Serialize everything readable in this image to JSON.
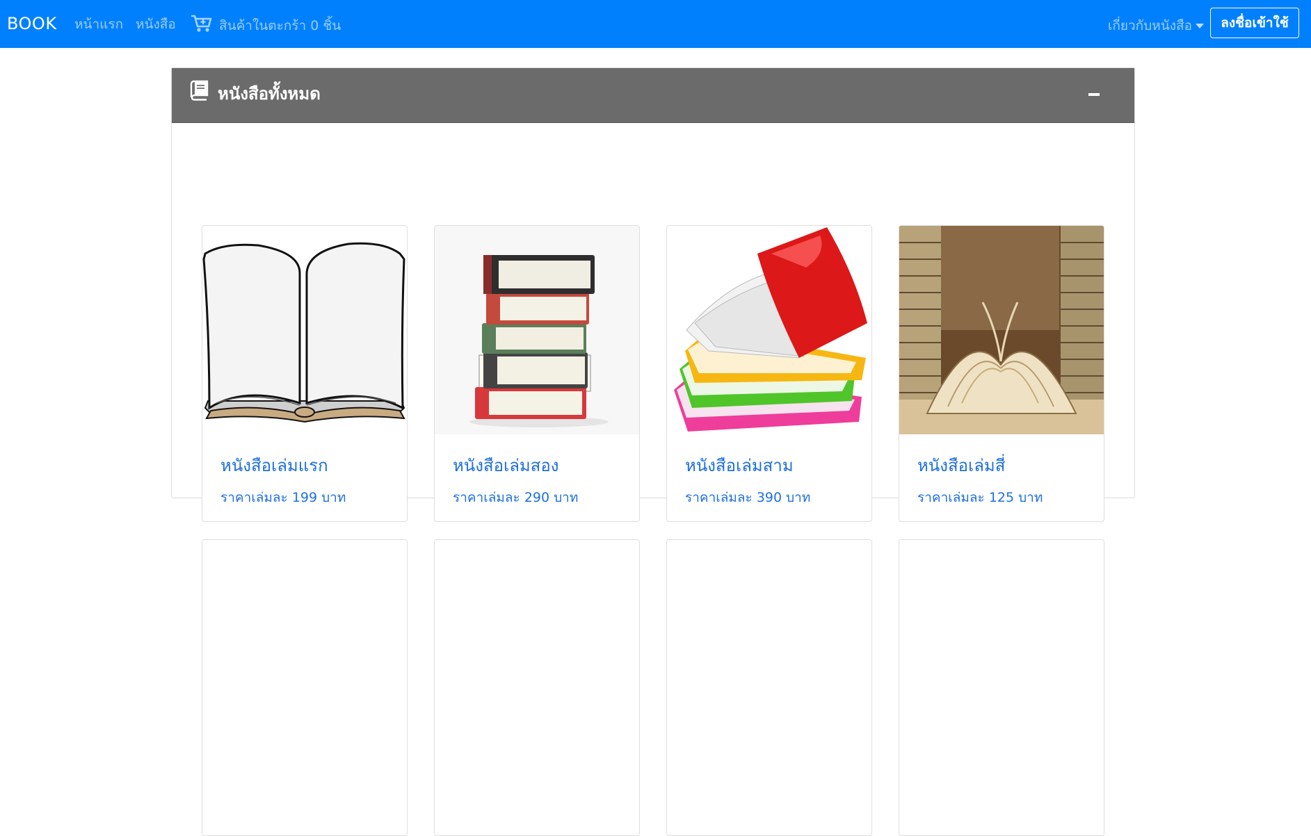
{
  "navbar": {
    "brand": "BOOK",
    "links": [
      "หน้าแรก",
      "หนังสือ"
    ],
    "cart_label": "สินค้าในตะกร้า 0 ชิ้น",
    "cart_icon": "cart-plus-icon",
    "dropdown_label": "เกี่ยวกับหนังสือ",
    "login_label": "ลงชื่อเข้าใช้",
    "background": "#0180fe"
  },
  "panel": {
    "title": "หนังสือทั้งหมด",
    "title_icon": "book-icon",
    "collapse_icon": "minus-icon",
    "header_background": "#6b6b6b"
  },
  "books": [
    {
      "title": "หนังสือเล่มแรก",
      "price_label": "ราคาเล่มละ",
      "price": "199",
      "unit": "บาท",
      "image": "open-blank-book"
    },
    {
      "title": "หนังสือเล่มสอง",
      "price_label": "ราคาเล่มละ",
      "price": "290",
      "unit": "บาท",
      "image": "book-stack"
    },
    {
      "title": "หนังสือเล่มสาม",
      "price_label": "ราคาเล่มละ",
      "price": "390",
      "unit": "บาท",
      "image": "colorful-book-stack"
    },
    {
      "title": "หนังสือเล่มสี่",
      "price_label": "ราคาเล่มละ",
      "price": "125",
      "unit": "บาท",
      "image": "library-open-book"
    }
  ],
  "accent_link_color": "#1d6fe0"
}
